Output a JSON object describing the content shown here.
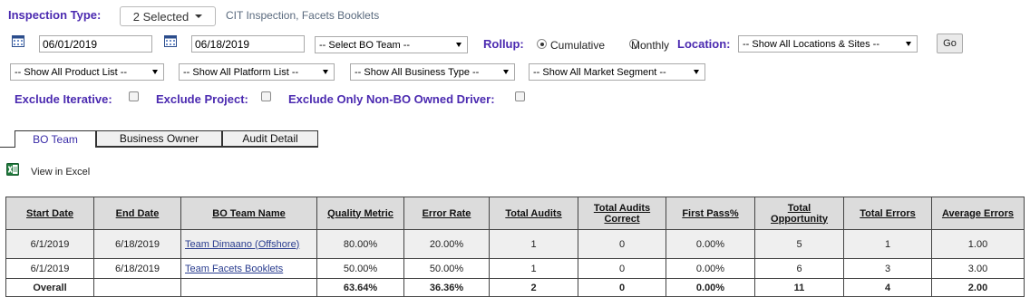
{
  "inspection": {
    "label": "Inspection Type:",
    "dropdown": "2 Selected",
    "selected_text": "CIT Inspection, Facets Booklets"
  },
  "filters": {
    "start_date": "06/01/2019",
    "end_date": "06/18/2019",
    "bo_team": "-- Select BO Team --",
    "rollup_label": "Rollup:",
    "rollup_options": [
      "Cumulative",
      "Monthly"
    ],
    "location_label": "Location:",
    "location": "-- Show All Locations & Sites --",
    "go": "Go",
    "product_list": "-- Show All Product List --",
    "platform_list": "-- Show All Platform List --",
    "business_type": "-- Show All Business Type --",
    "market_segment": "-- Show All Market Segment --",
    "exclude_iterative": "Exclude Iterative:",
    "exclude_project": "Exclude Project:",
    "exclude_non_bo": "Exclude Only Non-BO Owned Driver:"
  },
  "tabs": [
    "BO Team",
    "Business Owner",
    "Audit Detail"
  ],
  "excel": {
    "label": "View in Excel",
    "icon": "excel-icon"
  },
  "table": {
    "headers": [
      "Start Date",
      "End Date",
      "BO Team Name",
      "Quality Metric",
      "Error Rate",
      "Total Audits",
      "Total Audits Correct",
      "First Pass%",
      "Total Opportunity",
      "Total Errors",
      "Average Errors"
    ],
    "rows": [
      [
        "6/1/2019",
        "6/18/2019",
        "Team Dimaano (Offshore)",
        "80.00%",
        "20.00%",
        "1",
        "0",
        "0.00%",
        "5",
        "1",
        "1.00"
      ],
      [
        "6/1/2019",
        "6/18/2019",
        "Team Facets Booklets",
        "50.00%",
        "50.00%",
        "1",
        "0",
        "0.00%",
        "6",
        "3",
        "3.00"
      ]
    ],
    "total": [
      "Overall",
      "",
      "",
      "63.64%",
      "36.36%",
      "2",
      "0",
      "0.00%",
      "11",
      "4",
      "2.00"
    ]
  },
  "colors": {
    "label": "#4b2ab0",
    "header_bg": "#dcdcdc",
    "link": "#2a3d8f"
  }
}
